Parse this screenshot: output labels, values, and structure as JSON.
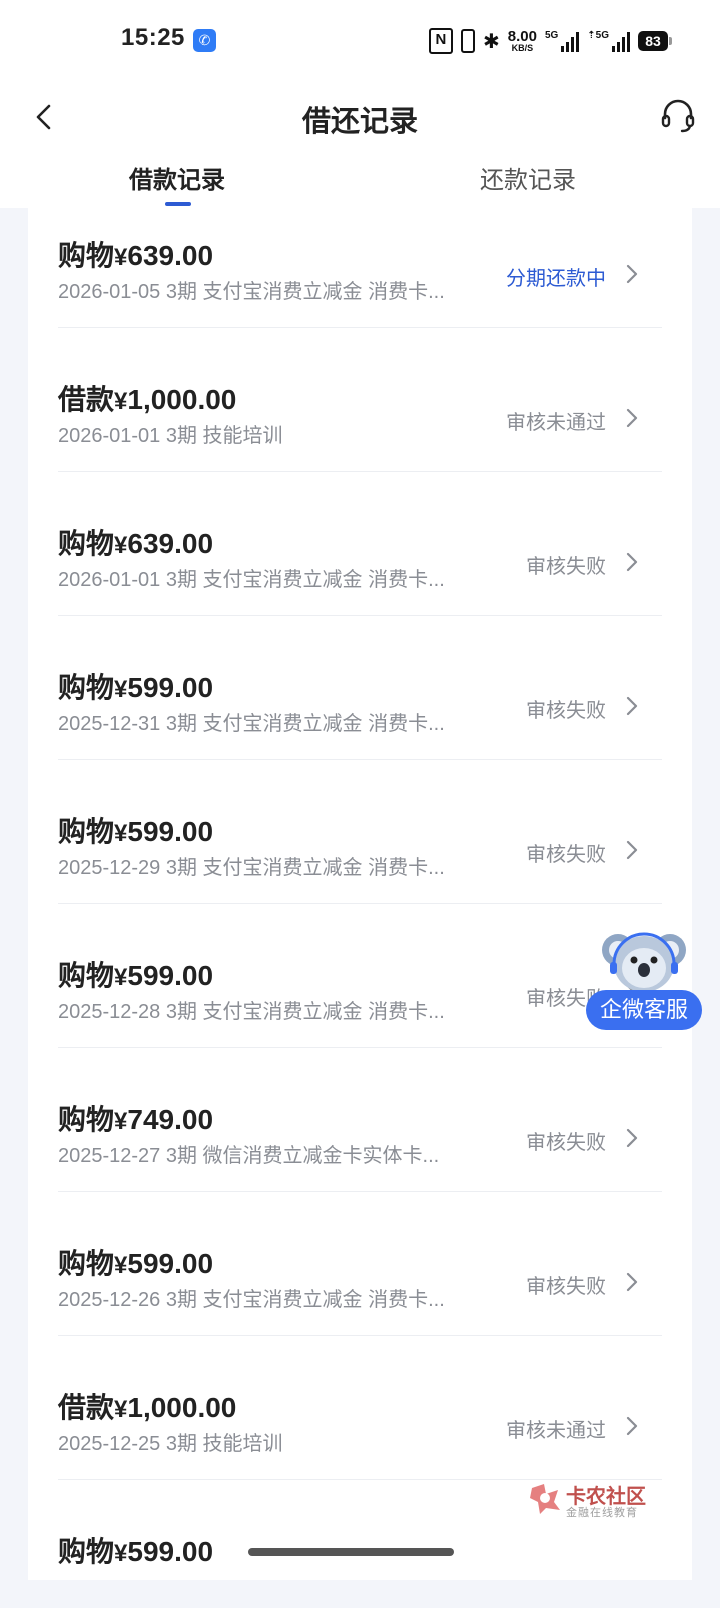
{
  "status_bar": {
    "time": "15:25",
    "nfc": "N",
    "bluetooth": "✱",
    "net_speed_value": "8.00",
    "net_speed_unit": "KB/S",
    "signal1_label": "5G",
    "signal2_label": "⇡5G",
    "battery": "83"
  },
  "header": {
    "title": "借还记录",
    "tabs": [
      {
        "label": "借款记录",
        "active": true
      },
      {
        "label": "还款记录",
        "active": false
      }
    ]
  },
  "colors": {
    "accent": "#2d5bd3",
    "muted_text": "#8a8d94",
    "page_bg": "#f3f5fa",
    "card_bg": "#ffffff"
  },
  "records": [
    {
      "type": "购物",
      "currency": "¥",
      "amount": "639.00",
      "meta": "2026-01-05 3期  支付宝消费立减金 消费卡...",
      "status": "分期还款中",
      "active": true
    },
    {
      "type": "借款",
      "currency": "¥",
      "amount": "1,000.00",
      "meta": "2026-01-01 3期  技能培训",
      "status": "审核未通过",
      "active": false
    },
    {
      "type": "购物",
      "currency": "¥",
      "amount": "639.00",
      "meta": "2026-01-01 3期  支付宝消费立减金 消费卡...",
      "status": "审核失败",
      "active": false
    },
    {
      "type": "购物",
      "currency": "¥",
      "amount": "599.00",
      "meta": "2025-12-31 3期  支付宝消费立减金 消费卡...",
      "status": "审核失败",
      "active": false
    },
    {
      "type": "购物",
      "currency": "¥",
      "amount": "599.00",
      "meta": "2025-12-29 3期  支付宝消费立减金 消费卡...",
      "status": "审核失败",
      "active": false
    },
    {
      "type": "购物",
      "currency": "¥",
      "amount": "599.00",
      "meta": "2025-12-28 3期  支付宝消费立减金 消费卡...",
      "status": "审核失败",
      "active": false
    },
    {
      "type": "购物",
      "currency": "¥",
      "amount": "749.00",
      "meta": "2025-12-27 3期  微信消费立减金卡实体卡...",
      "status": "审核失败",
      "active": false
    },
    {
      "type": "购物",
      "currency": "¥",
      "amount": "599.00",
      "meta": "2025-12-26 3期  支付宝消费立减金 消费卡...",
      "status": "审核失败",
      "active": false
    },
    {
      "type": "借款",
      "currency": "¥",
      "amount": "1,000.00",
      "meta": "2025-12-25 3期  技能培训",
      "status": "审核未通过",
      "active": false
    },
    {
      "type": "购物",
      "currency": "¥",
      "amount": "599.00",
      "meta": "",
      "status": "",
      "active": false
    }
  ],
  "float_service": {
    "label": "企微客服",
    "icon": "koala-mascot-icon"
  },
  "watermark": {
    "title": "卡农社区",
    "subtitle": "金融在线教育"
  }
}
